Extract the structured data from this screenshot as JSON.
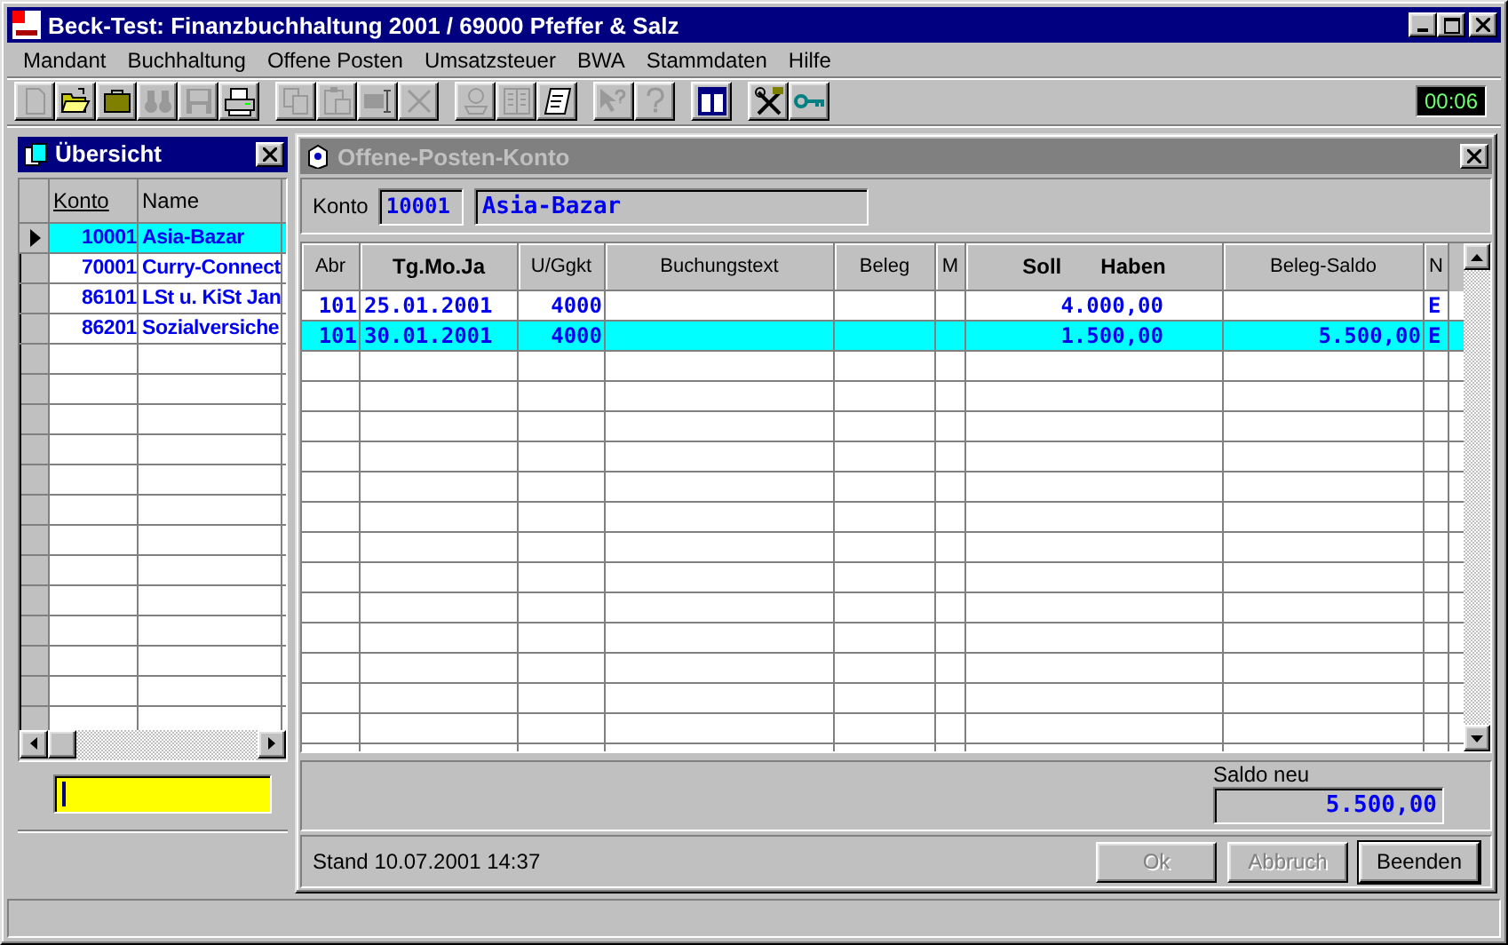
{
  "window": {
    "title": "Beck-Test: Finanzbuchhaltung 2001 / 69000 Pfeffer & Salz"
  },
  "menu": [
    "Mandant",
    "Buchhaltung",
    "Offene Posten",
    "Umsatzsteuer",
    "BWA",
    "Stammdaten",
    "Hilfe"
  ],
  "toolbar": [
    {
      "kind": "new",
      "disabled": true
    },
    {
      "kind": "open",
      "disabled": false
    },
    {
      "kind": "case",
      "disabled": false
    },
    {
      "kind": "binoculars",
      "disabled": true
    },
    {
      "kind": "save",
      "disabled": true
    },
    {
      "kind": "print",
      "disabled": false
    },
    {
      "kind": "sep"
    },
    {
      "kind": "copy",
      "disabled": true
    },
    {
      "kind": "paste",
      "disabled": true
    },
    {
      "kind": "rename",
      "disabled": true
    },
    {
      "kind": "delete",
      "disabled": true
    },
    {
      "kind": "sep"
    },
    {
      "kind": "stamp",
      "disabled": true
    },
    {
      "kind": "book",
      "disabled": true
    },
    {
      "kind": "scroll",
      "disabled": false
    },
    {
      "kind": "sep"
    },
    {
      "kind": "whatsthis",
      "disabled": true
    },
    {
      "kind": "help",
      "disabled": true
    },
    {
      "kind": "sep"
    },
    {
      "kind": "panes",
      "disabled": false
    },
    {
      "kind": "sep"
    },
    {
      "kind": "tools",
      "disabled": false
    },
    {
      "kind": "key",
      "disabled": false
    }
  ],
  "clock": "00:06",
  "overview": {
    "title": "Übersicht",
    "columns": [
      "Konto",
      "Name"
    ],
    "rows": [
      {
        "konto": "10001",
        "name": "Asia-Bazar",
        "selected": true
      },
      {
        "konto": "70001",
        "name": "Curry-Connect",
        "selected": false
      },
      {
        "konto": "86101",
        "name": "LSt u. KiSt Jan",
        "selected": false
      },
      {
        "konto": "86201",
        "name": "Sozialversiche",
        "selected": false
      }
    ]
  },
  "account": {
    "title": "Offene-Posten-Konto",
    "label": "Konto",
    "number": "10001",
    "name": "Asia-Bazar",
    "columns": [
      {
        "labels": [
          "Abr"
        ],
        "bold": false
      },
      {
        "labels": [
          "Tg.Mo.Ja"
        ],
        "bold": true
      },
      {
        "labels": [
          "U/Ggkt"
        ],
        "bold": false
      },
      {
        "labels": [
          "Buchungstext"
        ],
        "bold": false
      },
      {
        "labels": [
          "Beleg"
        ],
        "bold": false
      },
      {
        "labels": [
          "M"
        ],
        "bold": false
      },
      {
        "labels": [
          "Soll",
          "Haben"
        ],
        "bold": true
      },
      {
        "labels": [
          "Beleg-Saldo"
        ],
        "bold": false
      },
      {
        "labels": [
          "N"
        ],
        "bold": false
      }
    ],
    "rows": [
      {
        "abr": "101",
        "date": "25.01.2001",
        "gegenkonto": "4000",
        "amount": "4.000,00",
        "n": "E",
        "selected": false
      },
      {
        "abr": "101",
        "date": "30.01.2001",
        "gegenkonto": "4000",
        "amount": "1.500,00",
        "saldo": "5.500,00",
        "n": "E",
        "selected": true
      }
    ],
    "balance": {
      "label": "Saldo neu",
      "value": "5.500,00"
    },
    "status": "Stand 10.07.2001 14:37",
    "buttons": [
      {
        "label": "Ok",
        "disabled": true
      },
      {
        "label": "Abbruch",
        "disabled": true
      },
      {
        "label": "Beenden",
        "disabled": false
      }
    ]
  }
}
